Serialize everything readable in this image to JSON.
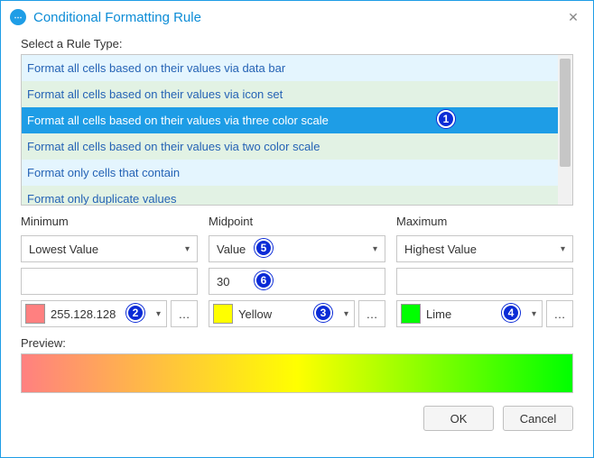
{
  "window": {
    "title": "Conditional Formatting Rule"
  },
  "ruleTypeLabel": "Select a Rule Type:",
  "rules": {
    "items": [
      "Format all cells based on their values via data bar",
      "Format all cells based on their values via icon set",
      "Format all cells based on their values via three color scale",
      "Format all cells based on their values via two color scale",
      "Format only cells that contain",
      "Format only duplicate values"
    ],
    "selectedIndex": 2
  },
  "columns": {
    "min": {
      "label": "Minimum",
      "type": "Lowest Value",
      "value": "",
      "colorName": "255.128.128",
      "colorHex": "#ff8080"
    },
    "mid": {
      "label": "Midpoint",
      "type": "Value",
      "value": "30",
      "colorName": "Yellow",
      "colorHex": "#ffff00"
    },
    "max": {
      "label": "Maximum",
      "type": "Highest Value",
      "value": "",
      "colorName": "Lime",
      "colorHex": "#00ff00"
    }
  },
  "previewLabel": "Preview:",
  "buttons": {
    "ok": "OK",
    "cancel": "Cancel"
  },
  "callouts": {
    "c1": "1",
    "c2": "2",
    "c3": "3",
    "c4": "4",
    "c5": "5",
    "c6": "6"
  }
}
